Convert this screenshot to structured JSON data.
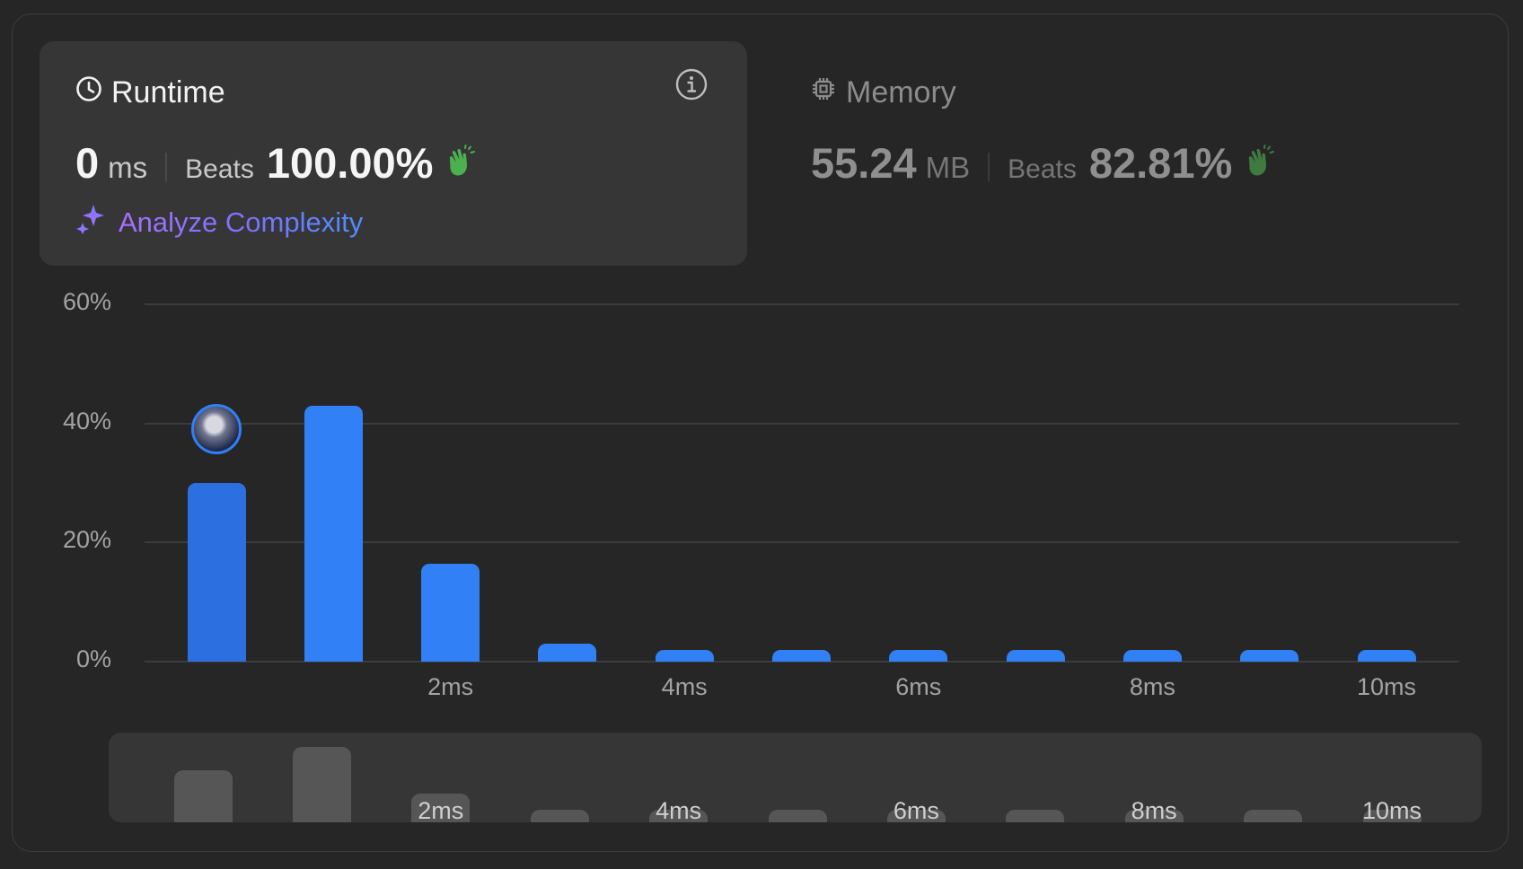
{
  "runtime": {
    "title": "Runtime",
    "value": "0",
    "unit": "ms",
    "beats_label": "Beats",
    "beats_value": "100.00%",
    "analyze_label": "Analyze Complexity"
  },
  "memory": {
    "title": "Memory",
    "value": "55.24",
    "unit": "MB",
    "beats_label": "Beats",
    "beats_value": "82.81%"
  },
  "colors": {
    "bar": "#3180f5",
    "bar_selected": "#2c6fe0",
    "clap": "#4caf50",
    "clap_dim": "#3f7a3f",
    "mini_bar": "#565656"
  },
  "icons": {
    "runtime": "clock-icon",
    "memory": "chip-icon",
    "info": "info-icon",
    "analyze": "sparkle-icon",
    "beats": "clap-icon"
  },
  "chart_data": {
    "type": "bar",
    "x": [
      0,
      1,
      2,
      3,
      4,
      5,
      6,
      7,
      8,
      9,
      10
    ],
    "values": [
      30,
      43,
      16.5,
      3,
      2,
      2,
      2,
      2,
      2,
      2,
      2
    ],
    "x_tick_labels": [
      {
        "x": 2,
        "label": "2ms"
      },
      {
        "x": 4,
        "label": "4ms"
      },
      {
        "x": 6,
        "label": "6ms"
      },
      {
        "x": 8,
        "label": "8ms"
      },
      {
        "x": 10,
        "label": "10ms"
      }
    ],
    "y_ticks": [
      "0%",
      "20%",
      "40%",
      "60%"
    ],
    "y_tick_values": [
      0,
      20,
      40,
      60
    ],
    "ylim": [
      0,
      60
    ],
    "selected_index": 0,
    "grid": true
  }
}
